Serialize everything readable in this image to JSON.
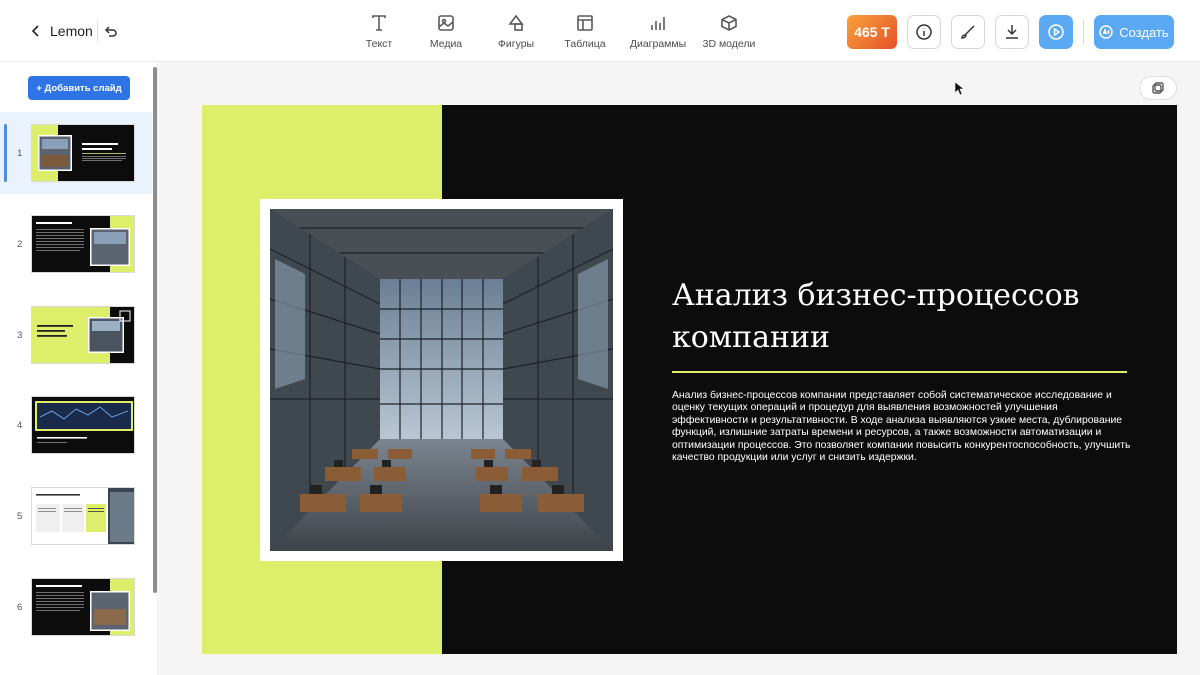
{
  "header": {
    "back_label": "Lemon",
    "tools": [
      {
        "label": "Текст",
        "icon": "text-icon"
      },
      {
        "label": "Медиа",
        "icon": "image-icon"
      },
      {
        "label": "Фигуры",
        "icon": "shapes-icon"
      },
      {
        "label": "Таблица",
        "icon": "table-icon"
      },
      {
        "label": "Диаграммы",
        "icon": "chart-icon"
      },
      {
        "label": "3D модели",
        "icon": "cube-icon"
      }
    ],
    "tokens": "465 T",
    "create_label": "Создать"
  },
  "sidebar": {
    "add_slide_label": "+ Добавить слайд",
    "slides": [
      {
        "number": "1",
        "active": true
      },
      {
        "number": "2",
        "active": false
      },
      {
        "number": "3",
        "active": false
      },
      {
        "number": "4",
        "active": false
      },
      {
        "number": "5",
        "active": false
      },
      {
        "number": "6",
        "active": false
      }
    ]
  },
  "slide": {
    "title": "Анализ бизнес-процессов компании",
    "text": "Анализ бизнес-процессов компании представляет собой систематическое исследование и оценку текущих операций и процедур для выявления возможностей улучшения эффективности и результативности. В ходе анализа выявляются узкие места, дублирование функций, излишние затраты времени и ресурсов, а также возможности автоматизации и оптимизации процессов. Это позволяет компании повысить конкурентоспособность, улучшить качество продукции или услуг и снизить издержки.",
    "accent_color": "#dcee6a",
    "background_color": "#0c0c0c"
  }
}
